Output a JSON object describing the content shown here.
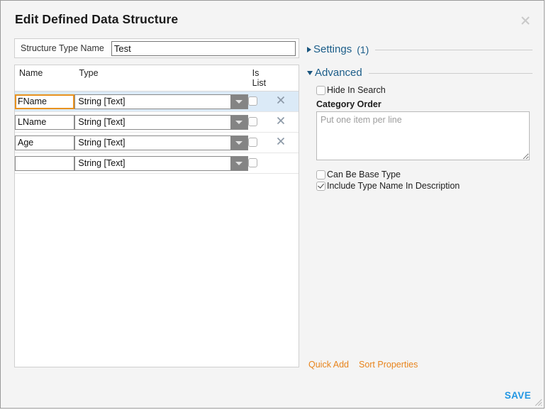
{
  "dialog": {
    "title": "Edit Defined Data Structure",
    "close_icon": "close-icon"
  },
  "structure_type": {
    "label": "Structure Type Name",
    "value": "Test",
    "placeholder": ""
  },
  "properties_table": {
    "headers": {
      "name": "Name",
      "type": "Type",
      "is_list_line1": "Is",
      "is_list_line2": "List"
    },
    "rows": [
      {
        "name": "FName",
        "type": "String [Text]",
        "is_list": false,
        "has_delete": true,
        "active": true,
        "name_placeholder": ""
      },
      {
        "name": "LName",
        "type": "String [Text]",
        "is_list": false,
        "has_delete": true,
        "active": false,
        "name_placeholder": ""
      },
      {
        "name": "Age",
        "type": "String [Text]",
        "is_list": false,
        "has_delete": true,
        "active": false,
        "name_placeholder": ""
      },
      {
        "name": "",
        "type": "String [Text]",
        "is_list": false,
        "has_delete": false,
        "active": false,
        "name_placeholder": ""
      }
    ]
  },
  "settings_section": {
    "label": "Settings",
    "count": "(1)",
    "expanded": false
  },
  "advanced_section": {
    "label": "Advanced",
    "expanded": true,
    "hide_in_search": {
      "label": "Hide In Search",
      "checked": false
    },
    "category_order": {
      "label": "Category Order",
      "value": "",
      "placeholder": "Put one item per line"
    },
    "can_be_base_type": {
      "label": "Can Be Base Type",
      "checked": false
    },
    "include_type_name": {
      "label": "Include Type Name In Description",
      "checked": true
    }
  },
  "footer": {
    "quick_add": "Quick Add",
    "sort_properties": "Sort Properties",
    "save": "SAVE"
  },
  "colors": {
    "accent_link": "#e8841c",
    "save_blue": "#2196e3",
    "section_blue": "#1b5d89",
    "row_highlight": "#dbeaf7",
    "focus_orange": "#e8921f"
  }
}
